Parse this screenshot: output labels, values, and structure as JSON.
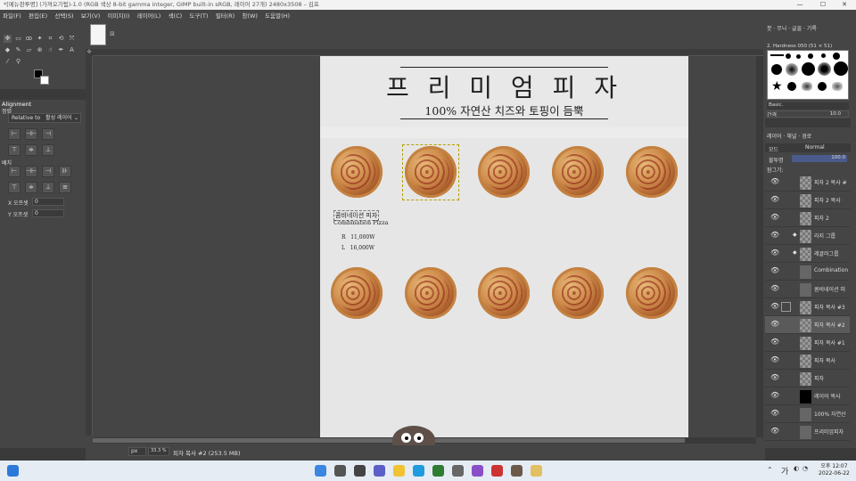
{
  "window": {
    "title": "*[메뉴판투명] (가져오기됨)-1.0 (RGB 색상 8-bit gamma integer, GIMP built-in sRGB, 레이어 27개) 2480x3508 – 김프",
    "min": "—",
    "max": "☐",
    "close": "✕"
  },
  "menu": [
    "파일(F)",
    "편집(E)",
    "선택(S)",
    "보기(V)",
    "이미지(I)",
    "레이어(L)",
    "색(C)",
    "도구(T)",
    "필터(R)",
    "창(W)",
    "도움말(H)"
  ],
  "alignment": {
    "title": "Alignment",
    "section": "정렬",
    "relative_label": "Relative to",
    "relative_value": "활성 레이어",
    "distribute": "배치",
    "x_label": "X 오프셋",
    "x_value": "0",
    "y_label": "Y 오프셋",
    "y_value": "0"
  },
  "doc": {
    "title": "프 리 미 엄 피 자",
    "subtitle": "100% 자연산 치즈와 토핑이 듬뿍",
    "item_name_ko": "콤비네이션 피자",
    "item_name_en": "Combination Pizza",
    "price_r": "R   11,000W",
    "price_l": "L   16,000W"
  },
  "brushes": {
    "tabs": [
      "붓",
      "무늬",
      "글꼴",
      "기록"
    ],
    "brush_name": "2. Hardness 050 (51 × 51)",
    "preset": "Basic.",
    "spacing_label": "간격",
    "spacing_value": "10.0"
  },
  "layers": {
    "tabs": [
      "레이어",
      "채널",
      "경로"
    ],
    "mode_label": "모드",
    "mode_value": "Normal",
    "opacity_label": "불투명",
    "opacity_value": "100.0",
    "lock_label": "잠그기:",
    "items": [
      {
        "name": "피자 2 복사 #"
      },
      {
        "name": "피자 2 복사"
      },
      {
        "name": "피자 2"
      },
      {
        "name": "라지 그룹"
      },
      {
        "name": "레귤러그룹"
      },
      {
        "name": "Combination"
      },
      {
        "name": "콤비네이션 피"
      },
      {
        "name": "피자 복사 #3"
      },
      {
        "name": "피자 복사 #2"
      },
      {
        "name": "피자 복사 #1"
      },
      {
        "name": "피자 복사"
      },
      {
        "name": "피자"
      },
      {
        "name": "레이어 복사"
      },
      {
        "name": "100% 자연산"
      },
      {
        "name": "프리미엄피자"
      }
    ]
  },
  "status": {
    "unit": "px",
    "zoom": "33.3 %",
    "info": "피자 복사 #2 (253.5 MB)"
  },
  "taskbar": {
    "time": "오후 12:07",
    "date": "2022-06-22",
    "lang": "가"
  },
  "colors": {
    "accent": "#e0a020",
    "bg": "#454545"
  }
}
